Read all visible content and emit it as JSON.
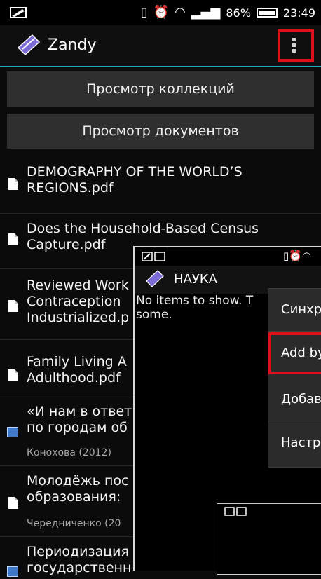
{
  "status": {
    "battery": "86%",
    "time": "23:49"
  },
  "app": {
    "title": "Zandy"
  },
  "buttons": {
    "collections": "Просмотр коллекций",
    "documents": "Просмотр документов"
  },
  "items": [
    {
      "title": "DEMOGRAPHY OF THE WORLD’S\nREGIONS.pdf",
      "sub": ""
    },
    {
      "title": "Does the Household-Based Census\nCapture.pdf",
      "sub": ""
    },
    {
      "title": "Reviewed Work\nContraception \nIndustrialized.p",
      "sub": ""
    },
    {
      "title": "Family Living A\nAdulthood.pdf",
      "sub": ""
    },
    {
      "title": "«И нам в ответ\nпо городам об",
      "sub": "Конохова (2012)"
    },
    {
      "title": "Молодёжь пос\nобразования:",
      "sub": "Чередниченко (20"
    },
    {
      "title": "Периодизация\nгосударственн",
      "sub": ""
    }
  ],
  "overlay": {
    "title": "НАУКА",
    "empty": "No items to show. T some.",
    "menu": [
      "Синхр",
      "Add by",
      "Добав",
      "Настр"
    ]
  }
}
